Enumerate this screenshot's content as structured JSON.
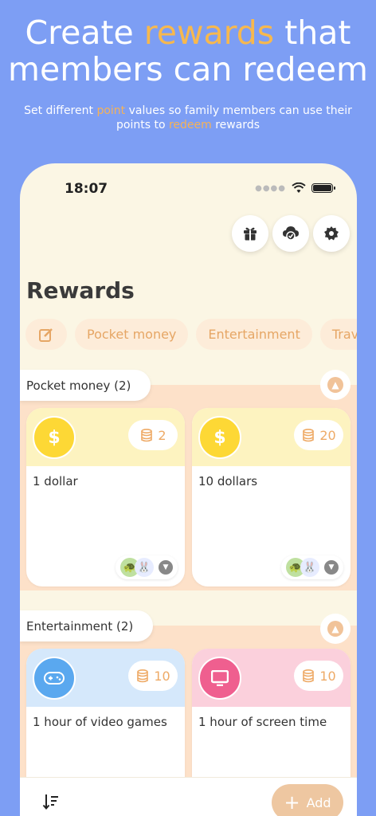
{
  "headline": {
    "part1": "Create ",
    "highlight": "rewards",
    "part2": " that",
    "line2": "members can redeem"
  },
  "subline": {
    "a": "Set different ",
    "point": "point",
    "b": " values so family members can use their",
    "c": "points to ",
    "redeem": "redeem",
    "d": " rewards"
  },
  "status": {
    "time": "18:07"
  },
  "page": {
    "title": "Rewards"
  },
  "chips": [
    "Pocket money",
    "Entertainment",
    "Travel"
  ],
  "sections": [
    {
      "label": "Pocket money (2)",
      "cards": [
        {
          "title": "1 dollar",
          "points": "2",
          "icon": "dollar-icon",
          "symbol": "$"
        },
        {
          "title": "10 dollars",
          "points": "20",
          "icon": "dollar-icon",
          "symbol": "$"
        }
      ]
    },
    {
      "label": "Entertainment (2)",
      "cards": [
        {
          "title": "1 hour of video games",
          "points": "10",
          "icon": "gamepad-icon"
        },
        {
          "title": "1 hour of screen time",
          "points": "10",
          "icon": "monitor-icon"
        }
      ]
    }
  ],
  "bottom": {
    "add_label": "Add"
  },
  "colors": {
    "background": "#7d9ef4",
    "accent": "#f7b84e",
    "phone_bg": "#fbf6e4",
    "section_bg": "#fde1c9",
    "dollar_yellow": "#fdd835",
    "game_blue": "#5aa8ef",
    "screen_pink": "#ef5f8f"
  }
}
